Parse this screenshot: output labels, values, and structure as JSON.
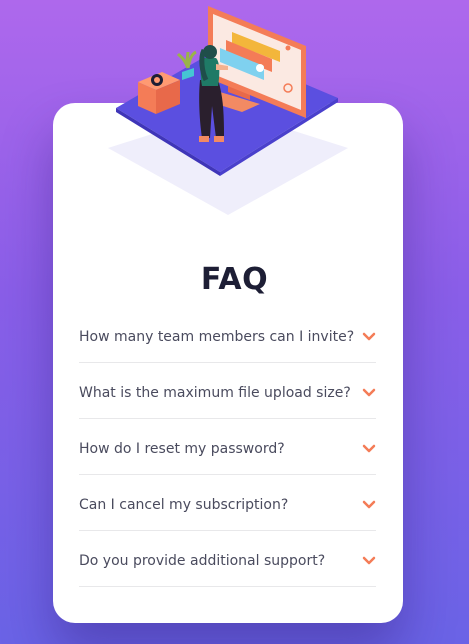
{
  "page": {
    "title": "FAQ"
  },
  "colors": {
    "background_top": "#ae68ec",
    "background_bottom": "#6a63e6",
    "card": "#ffffff",
    "title": "#1d1e35",
    "question_text": "#4a4b5e",
    "accent": "#f47c57",
    "divider": "#e8e8ea"
  },
  "faq": {
    "items": [
      {
        "question": "How many team members can I invite?",
        "icon": "chevron-down-icon",
        "expanded": false
      },
      {
        "question": "What is the maximum file upload size?",
        "icon": "chevron-down-icon",
        "expanded": false
      },
      {
        "question": "How do I reset my password?",
        "icon": "chevron-down-icon",
        "expanded": false
      },
      {
        "question": "Can I cancel my subscription?",
        "icon": "chevron-down-icon",
        "expanded": false
      },
      {
        "question": "Do you provide additional support?",
        "icon": "chevron-down-icon",
        "expanded": false
      }
    ]
  },
  "illustration": {
    "icon": "woman-online-illustration"
  }
}
